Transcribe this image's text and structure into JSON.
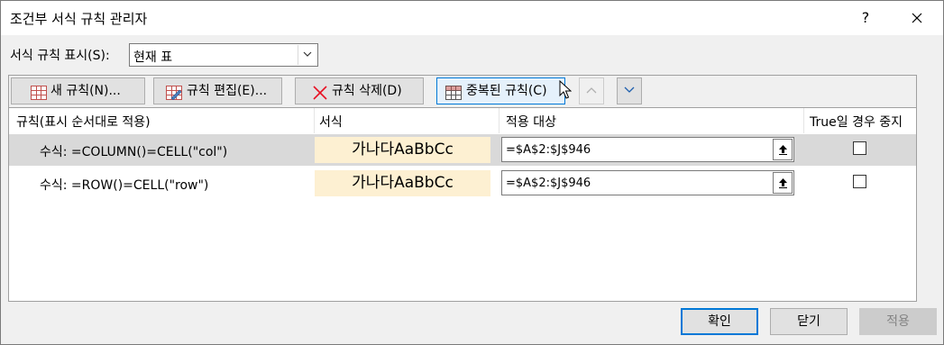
{
  "window": {
    "title": "조건부 서식 규칙 관리자",
    "help": "?"
  },
  "show_rules": {
    "label": "서식 규칙 표시(S):",
    "selected": "현재 표"
  },
  "toolbar": {
    "new_rule": "새 규칙(N)...",
    "edit_rule": "규칙 편집(E)...",
    "delete_rule": "규칙 삭제(D)",
    "duplicate_rule": "중복된 규칙(C)"
  },
  "columns": {
    "rule": "규칙(표시 순서대로 적용)",
    "format": "서식",
    "applies_to": "적용 대상",
    "stop_if_true": "True일 경우 중지"
  },
  "rules": [
    {
      "formula": "수식: =COLUMN()=CELL(\"col\")",
      "preview": "가나다AaBbCc",
      "applies_to": "=$A$2:$J$946",
      "stop_if_true": false,
      "selected": true
    },
    {
      "formula": "수식: =ROW()=CELL(\"row\")",
      "preview": "가나다AaBbCc",
      "applies_to": "=$A$2:$J$946",
      "stop_if_true": false,
      "selected": false
    }
  ],
  "buttons": {
    "ok": "확인",
    "close": "닫기",
    "apply": "적용"
  },
  "colors": {
    "preview_fill": "#fdf0d2",
    "selection": "#d9d9d9",
    "accent": "#0078d7",
    "delete_x": "#e81123"
  }
}
